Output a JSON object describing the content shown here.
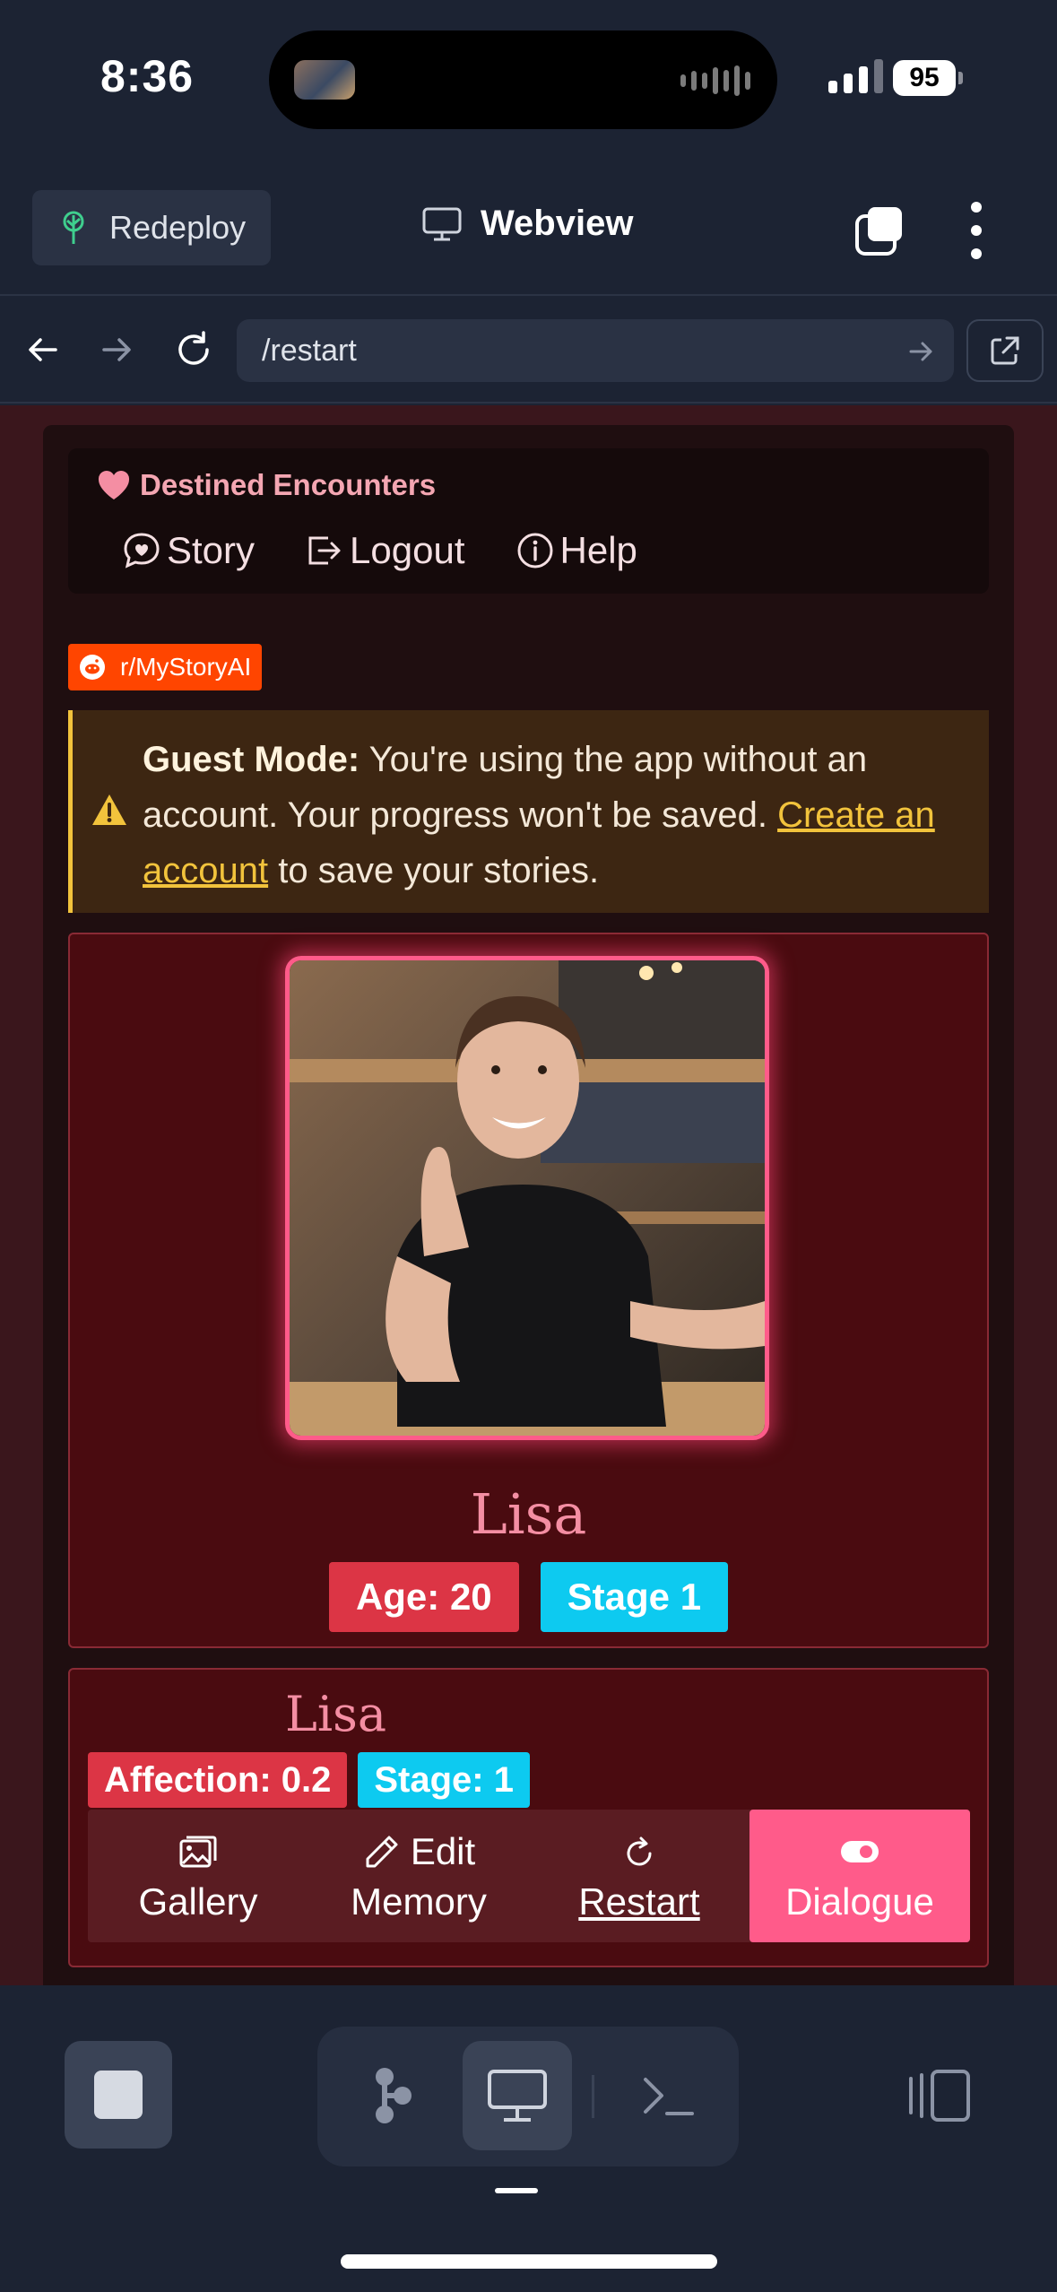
{
  "status_bar": {
    "time": "8:36",
    "battery": "95"
  },
  "app_header": {
    "redeploy_label": "Redeploy",
    "title": "Webview"
  },
  "url_bar": {
    "url": "/restart"
  },
  "site": {
    "brand": "Destined Encounters",
    "nav": [
      {
        "label": "Story",
        "icon": "speech-heart-icon"
      },
      {
        "label": "Logout",
        "icon": "logout-icon"
      },
      {
        "label": "Help",
        "icon": "info-icon"
      }
    ],
    "reddit_badge": "r/MyStoryAI",
    "guest": {
      "strong": "Guest Mode:",
      "text1": " You're using the app without an account. Your progress won't be saved. ",
      "link": "Create an account",
      "text2": " to save your stories."
    },
    "profile": {
      "name": "Lisa",
      "age_badge": "Age: 20",
      "stage_badge": "Stage 1"
    },
    "chat": {
      "name": "Lisa",
      "affection_badge": "Affection: 0.2",
      "stage_badge": "Stage: 1",
      "actions": [
        {
          "label": "Gallery",
          "icon": "image-icon"
        },
        {
          "label_top": "Edit",
          "label": "Memory",
          "icon": "pencil-icon"
        },
        {
          "label": "Restart",
          "icon": "restart-icon"
        },
        {
          "label": "Dialogue",
          "icon": "toggle-icon"
        }
      ]
    }
  },
  "colors": {
    "accent_pink": "#ff5b8a",
    "badge_red": "#dc3545",
    "badge_cyan": "#0dcaf0",
    "warning": "#f2c33c"
  }
}
